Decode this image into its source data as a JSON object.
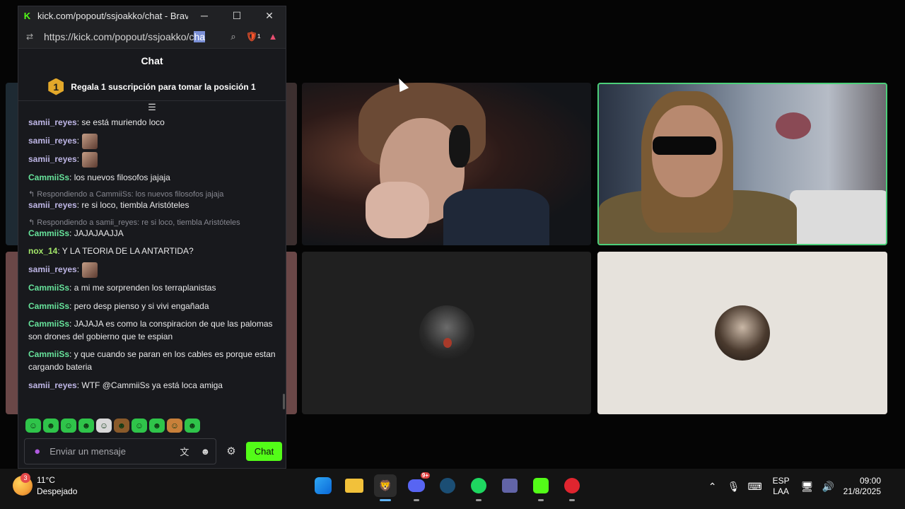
{
  "browser": {
    "window_title": "kick.com/popout/ssjoakko/chat - Brave",
    "url_prefix": "https://kick.com/popout/ssjoakko/c",
    "url_selected": "ha",
    "logo_letter": "K",
    "btn_minimize": "─",
    "btn_maximize": "☐",
    "btn_close": "✕",
    "shield_badge": "1"
  },
  "chat": {
    "header": "Chat",
    "rank_number": "1",
    "sub_banner": "Regala 1 suscripción para tomar la posición 1",
    "messages": [
      {
        "user": "samii_reyes",
        "text": ": se está muriendo loco",
        "reply": ""
      },
      {
        "user": "samii_reyes",
        "text": ":",
        "reply": "",
        "emote": true
      },
      {
        "user": "samii_reyes",
        "text": ":",
        "reply": "",
        "emote": true
      },
      {
        "user": "CammiiSs",
        "text": ": los nuevos filosofos jajaja",
        "reply": ""
      },
      {
        "user": "samii_reyes",
        "text": ": re si loco, tiembla Aristóteles",
        "reply": "Respondiendo a CammiiSs: los nuevos filosofos jajaja"
      },
      {
        "user": "CammiiSs",
        "text": ": JAJAJAAJJA",
        "reply": "Respondiendo a samii_reyes: re si loco, tiembla Aristóteles"
      },
      {
        "user": "nox_14",
        "text": ": Y LA TEORIA DE LA ANTARTIDA?",
        "reply": ""
      },
      {
        "user": "samii_reyes",
        "text": ":",
        "reply": "",
        "emote": true
      },
      {
        "user": "CammiiSs",
        "text": ": a mi me sorprenden los terraplanistas",
        "reply": ""
      },
      {
        "user": "CammiiSs",
        "text": ": pero desp pienso y si vivi engañada",
        "reply": ""
      },
      {
        "user": "CammiiSs",
        "text": ": JAJAJA es como la conspiracion de que las palomas son drones del gobierno que te espian",
        "reply": ""
      },
      {
        "user": "CammiiSs",
        "text": ": y que cuando se paran en los cables es porque estan cargando bateria",
        "reply": ""
      },
      {
        "user": "samii_reyes",
        "text": ": WTF @CammiiSs ya está loca amiga",
        "reply": ""
      }
    ],
    "input_placeholder": "Enviar un mensaje",
    "send_label": "Chat"
  },
  "taskbar": {
    "weather_temp": "11°C",
    "weather_desc": "Despejado",
    "weather_badge": "3",
    "discord_badge": "9+",
    "lang_line1": "ESP",
    "lang_line2": "LAA",
    "time": "09:00",
    "date": "21/8/2025"
  },
  "colors": {
    "kick_green": "#53fc18",
    "active_speaker_border": "#4cd07a",
    "chat_bg": "#18191d"
  }
}
